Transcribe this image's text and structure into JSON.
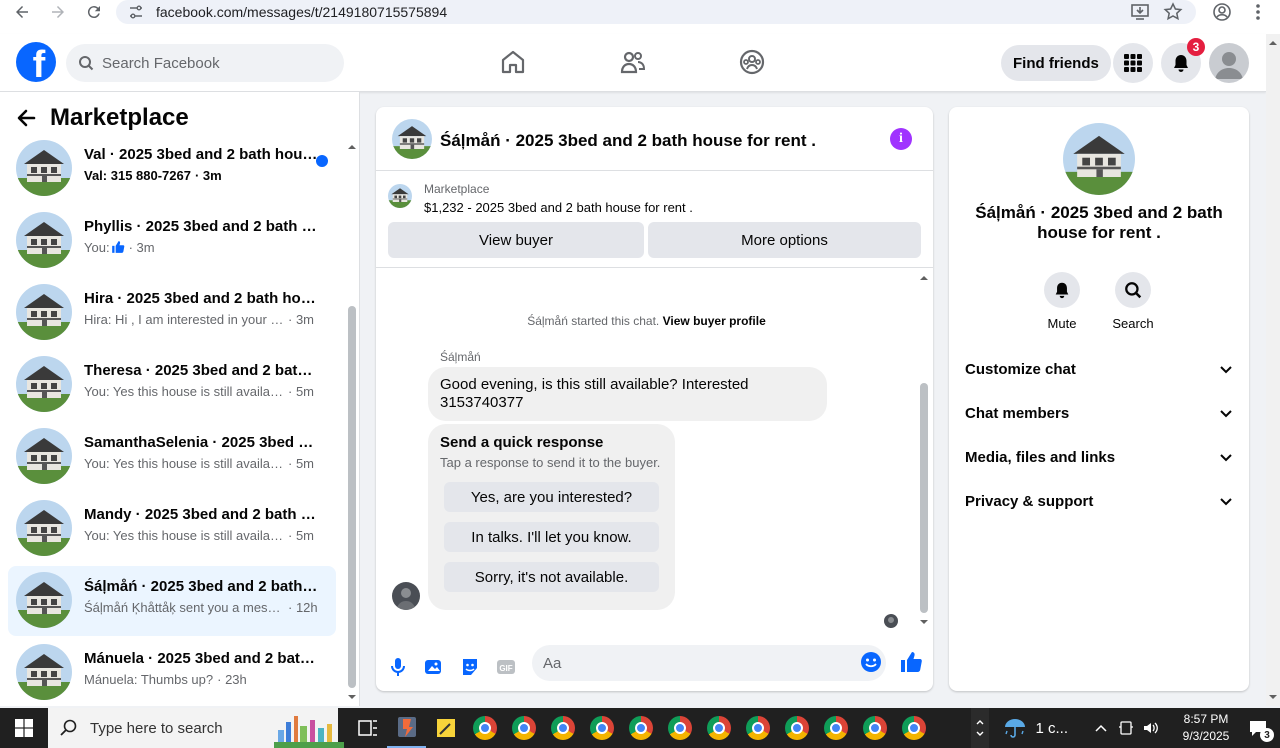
{
  "browser": {
    "url": "facebook.com/messages/t/2149180715575894"
  },
  "header": {
    "search_placeholder": "Search Facebook",
    "find_friends": "Find friends",
    "notification_count": "3"
  },
  "sidebar": {
    "title": "Marketplace",
    "conversations": [
      {
        "name": "Val · 2025 3bed and 2 bath house for rent .",
        "snippet": "Val: 315 880-7267",
        "time": "· 3m",
        "unread": true
      },
      {
        "name": "Phyllis · 2025 3bed and 2 bath house for rent .",
        "snippet": "You: ",
        "time": "· 3m",
        "like": true
      },
      {
        "name": "Hira · 2025 3bed and 2 bath house for rent .",
        "snippet": "Hira: Hi , I am interested in your house for rent",
        "time": "· 3m"
      },
      {
        "name": "Theresa · 2025 3bed and 2 bath house for rent .",
        "snippet": "You: Yes this house is still available for rent",
        "time": "· 5m"
      },
      {
        "name": "SamanthaSelenia · 2025 3bed and 2 bath house for rent .",
        "snippet": "You: Yes this house is still available for rent",
        "time": "· 5m"
      },
      {
        "name": "Mandy · 2025 3bed and 2 bath house for rent .",
        "snippet": "You: Yes this house is still available for rent",
        "time": "· 5m"
      },
      {
        "name": "Śáļmåń · 2025 3bed and 2 bath house for rent .",
        "snippet": "Śáļmåń Ķhåttåķ sent you a message",
        "time": "· 12h",
        "active": true
      },
      {
        "name": "Mánuela · 2025 3bed and 2 bath house for rent .",
        "snippet": "Mánuela: Thumbs up?",
        "time": "· 23h"
      }
    ]
  },
  "chat": {
    "title": "Śáļmåń · 2025 3bed and 2 bath house for rent .",
    "marketplace_label": "Marketplace",
    "listing": "$1,232 - 2025 3bed and 2 bath house for rent .",
    "view_buyer": "View buyer",
    "more_options": "More options",
    "system_msg_prefix": "Śáļmåń started this chat.",
    "system_msg_link": "View buyer profile",
    "sender_name": "Śáļmåń",
    "message": "Good evening, is this still available? Interested 3153740377",
    "quick_title": "Send a quick response",
    "quick_sub": "Tap a response to send it to the buyer.",
    "quick_responses": [
      "Yes, are you interested?",
      "In talks. I'll let you know.",
      "Sorry, it's not available."
    ],
    "composer_placeholder": "Aa"
  },
  "info_panel": {
    "title": "Śáļmåń · 2025 3bed and 2 bath house for rent .",
    "mute": "Mute",
    "search": "Search",
    "sections": [
      "Customize chat",
      "Chat members",
      "Media, files and links",
      "Privacy & support"
    ]
  },
  "taskbar": {
    "search_placeholder": "Type here to search",
    "weather": "1 c...",
    "time": "8:57 PM",
    "date": "9/3/2025",
    "notification_count": "3"
  },
  "colors": {
    "fb_blue": "#0866ff",
    "messenger_purple": "#a033ff",
    "active_bg": "#ebf5ff"
  }
}
